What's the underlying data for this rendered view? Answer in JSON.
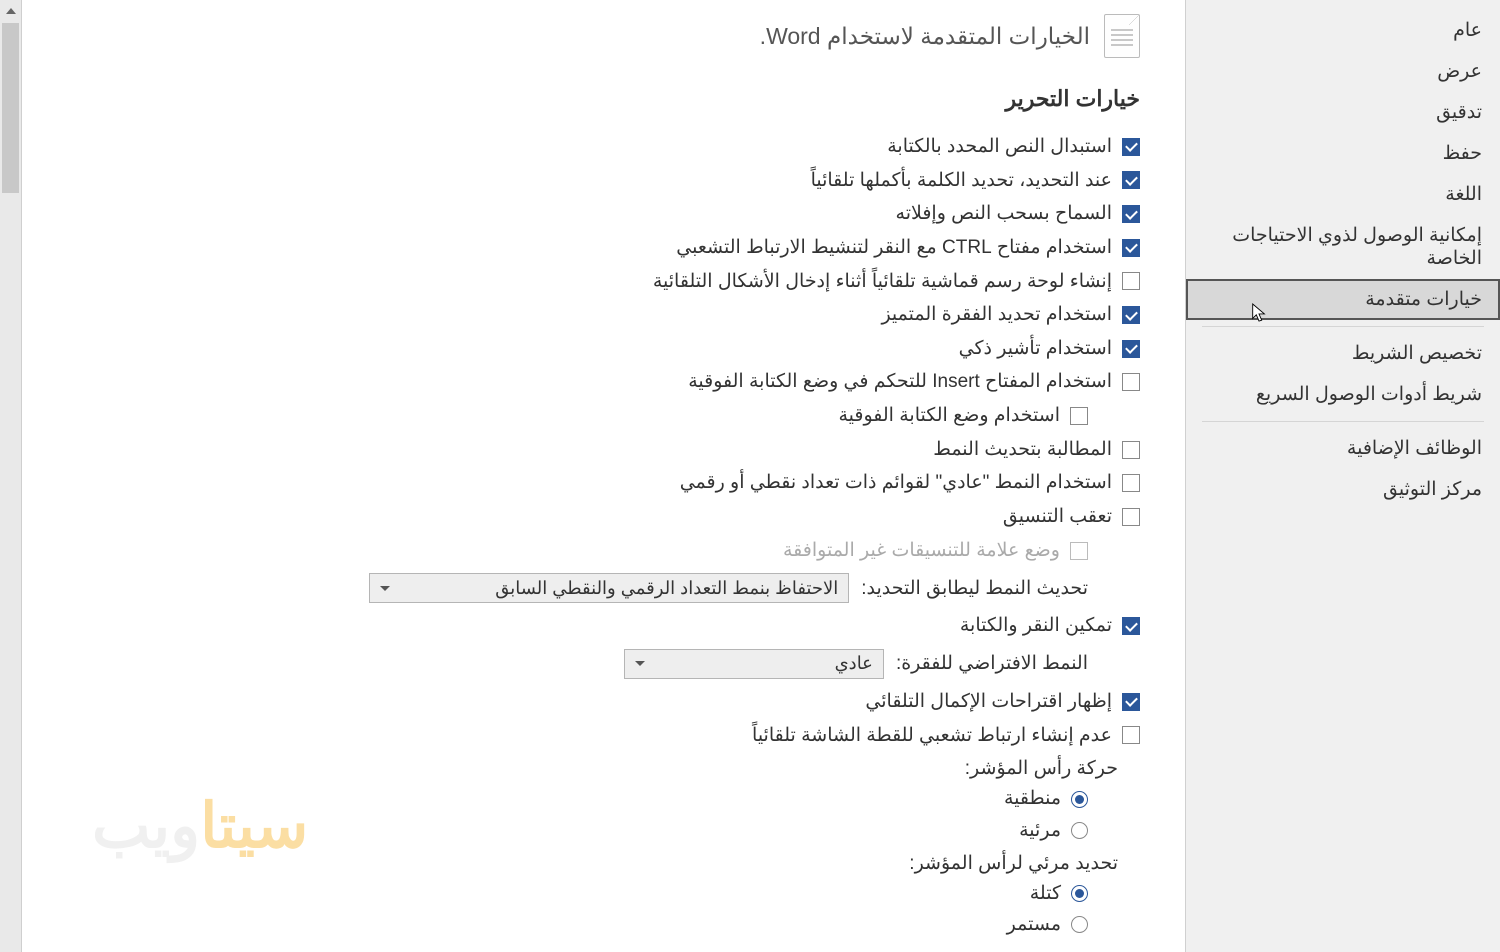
{
  "sidebar": {
    "items": [
      {
        "label": "عام"
      },
      {
        "label": "عرض"
      },
      {
        "label": "تدقيق"
      },
      {
        "label": "حفظ"
      },
      {
        "label": "اللغة"
      },
      {
        "label": "إمكانية الوصول لذوي الاحتياجات الخاصة"
      },
      {
        "label": "خيارات متقدمة",
        "selected": true
      },
      {
        "label": "تخصيص الشريط"
      },
      {
        "label": "شريط أدوات الوصول السريع"
      },
      {
        "label": "الوظائف الإضافية"
      },
      {
        "label": "مركز التوثيق"
      }
    ]
  },
  "header": {
    "title": "الخيارات المتقدمة لاستخدام Word."
  },
  "section_editing": "خيارات التحرير",
  "options": [
    {
      "checked": true,
      "label": "استبدال النص المحدد بالكتابة"
    },
    {
      "checked": true,
      "label": "عند التحديد، تحديد الكلمة بأكملها تلقائياً"
    },
    {
      "checked": true,
      "label": "السماح بسحب النص وإفلاته"
    },
    {
      "checked": true,
      "label": "استخدام مفتاح CTRL مع النقر لتنشيط الارتباط التشعبي"
    },
    {
      "checked": false,
      "label": "إنشاء لوحة رسم قماشية تلقائياً أثناء إدخال الأشكال التلقائية"
    },
    {
      "checked": true,
      "label": "استخدام تحديد الفقرة المتميز"
    },
    {
      "checked": true,
      "label": "استخدام تأشير ذكي"
    },
    {
      "checked": false,
      "label": "استخدام المفتاح Insert للتحكم في وضع الكتابة الفوقية"
    },
    {
      "checked": false,
      "label": "استخدام وضع الكتابة الفوقية",
      "indent": true
    },
    {
      "checked": false,
      "label": "المطالبة بتحديث النمط"
    },
    {
      "checked": false,
      "label": "استخدام النمط \"عادي\" لقوائم ذات تعداد نقطي أو رقمي"
    },
    {
      "checked": false,
      "label": "تعقب التنسيق"
    },
    {
      "checked": false,
      "label": "وضع علامة للتنسيقات غير المتوافقة",
      "disabled": true,
      "indent": true
    }
  ],
  "style_update_label": "تحديث النمط ليطابق التحديد:",
  "style_update_value": "الاحتفاظ بنمط التعداد الرقمي والنقطي السابق",
  "click_type": {
    "checked": true,
    "label": "تمكين النقر والكتابة"
  },
  "default_para_label": "النمط الافتراضي للفقرة:",
  "default_para_value": "عادي",
  "autocomplete": {
    "checked": true,
    "label": "إظهار اقتراحات الإكمال التلقائي"
  },
  "no_hyperlink_screenshot": {
    "checked": false,
    "label": "عدم إنشاء ارتباط تشعبي للقطة الشاشة تلقائياً"
  },
  "cursor_movement": {
    "label": "حركة رأس المؤشر:",
    "options": [
      {
        "label": "منطقية",
        "selected": true
      },
      {
        "label": "مرئية",
        "selected": false
      }
    ]
  },
  "visual_cursor": {
    "label": "تحديد مرئي لرأس المؤشر:",
    "options": [
      {
        "label": "كتلة",
        "selected": true
      },
      {
        "label": "مستمر",
        "selected": false
      }
    ]
  },
  "watermark": {
    "p1": "سيتا",
    "p2": "ويب"
  }
}
